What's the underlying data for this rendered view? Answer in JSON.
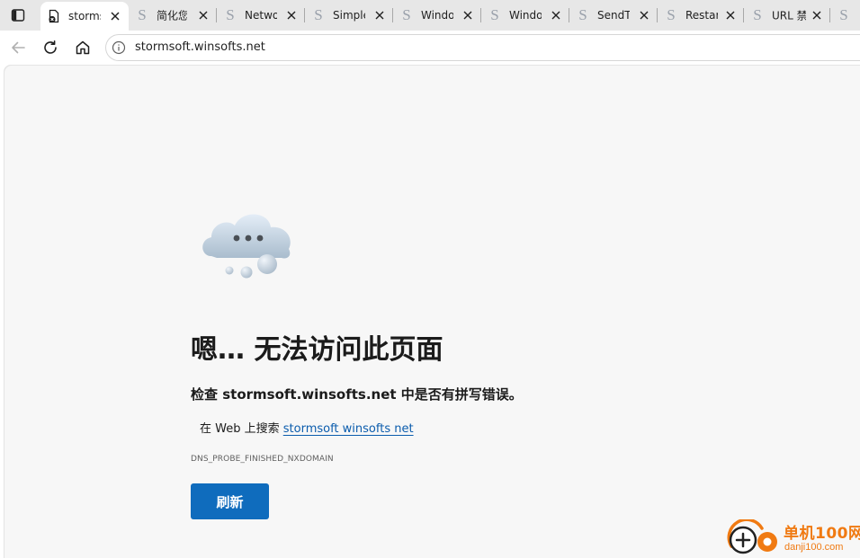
{
  "browser": {
    "tabs": [
      {
        "title": "storms",
        "active": true,
        "favicon": "broken-page-icon",
        "closable": true
      },
      {
        "title": "简化您",
        "active": false,
        "favicon": "s-site-icon",
        "closable": true
      },
      {
        "title": "Netwo",
        "active": false,
        "favicon": "s-site-icon",
        "closable": true
      },
      {
        "title": "Simple",
        "active": false,
        "favicon": "s-site-icon",
        "closable": true
      },
      {
        "title": "Windo",
        "active": false,
        "favicon": "s-site-icon",
        "closable": true
      },
      {
        "title": "Windo",
        "active": false,
        "favicon": "s-site-icon",
        "closable": true
      },
      {
        "title": "SendTo",
        "active": false,
        "favicon": "s-site-icon",
        "closable": true
      },
      {
        "title": "Restar",
        "active": false,
        "favicon": "s-site-icon",
        "closable": true
      },
      {
        "title": "URL 禁",
        "active": false,
        "favicon": "s-site-icon",
        "closable": true
      },
      {
        "title": "",
        "active": false,
        "favicon": "s-site-icon",
        "closable": false
      }
    ],
    "address": "stormsoft.winsofts.net"
  },
  "error_page": {
    "title": "嗯… 无法访问此页面",
    "hint": "检查 stormsoft.winsofts.net 中是否有拼写错误。",
    "search_prefix": "在 Web 上搜索 ",
    "search_link": "stormsoft winsofts net",
    "error_code": "DNS_PROBE_FINISHED_NXDOMAIN",
    "refresh_label": "刷新"
  },
  "watermark": {
    "name": "单机100网",
    "domain": "danji100.com"
  },
  "colors": {
    "accent": "#0f6cbd",
    "link": "#0b5cad",
    "watermark": "#f07a12",
    "page_background": "#f7f7f7",
    "tabstrip_background": "#e7e7e7"
  }
}
